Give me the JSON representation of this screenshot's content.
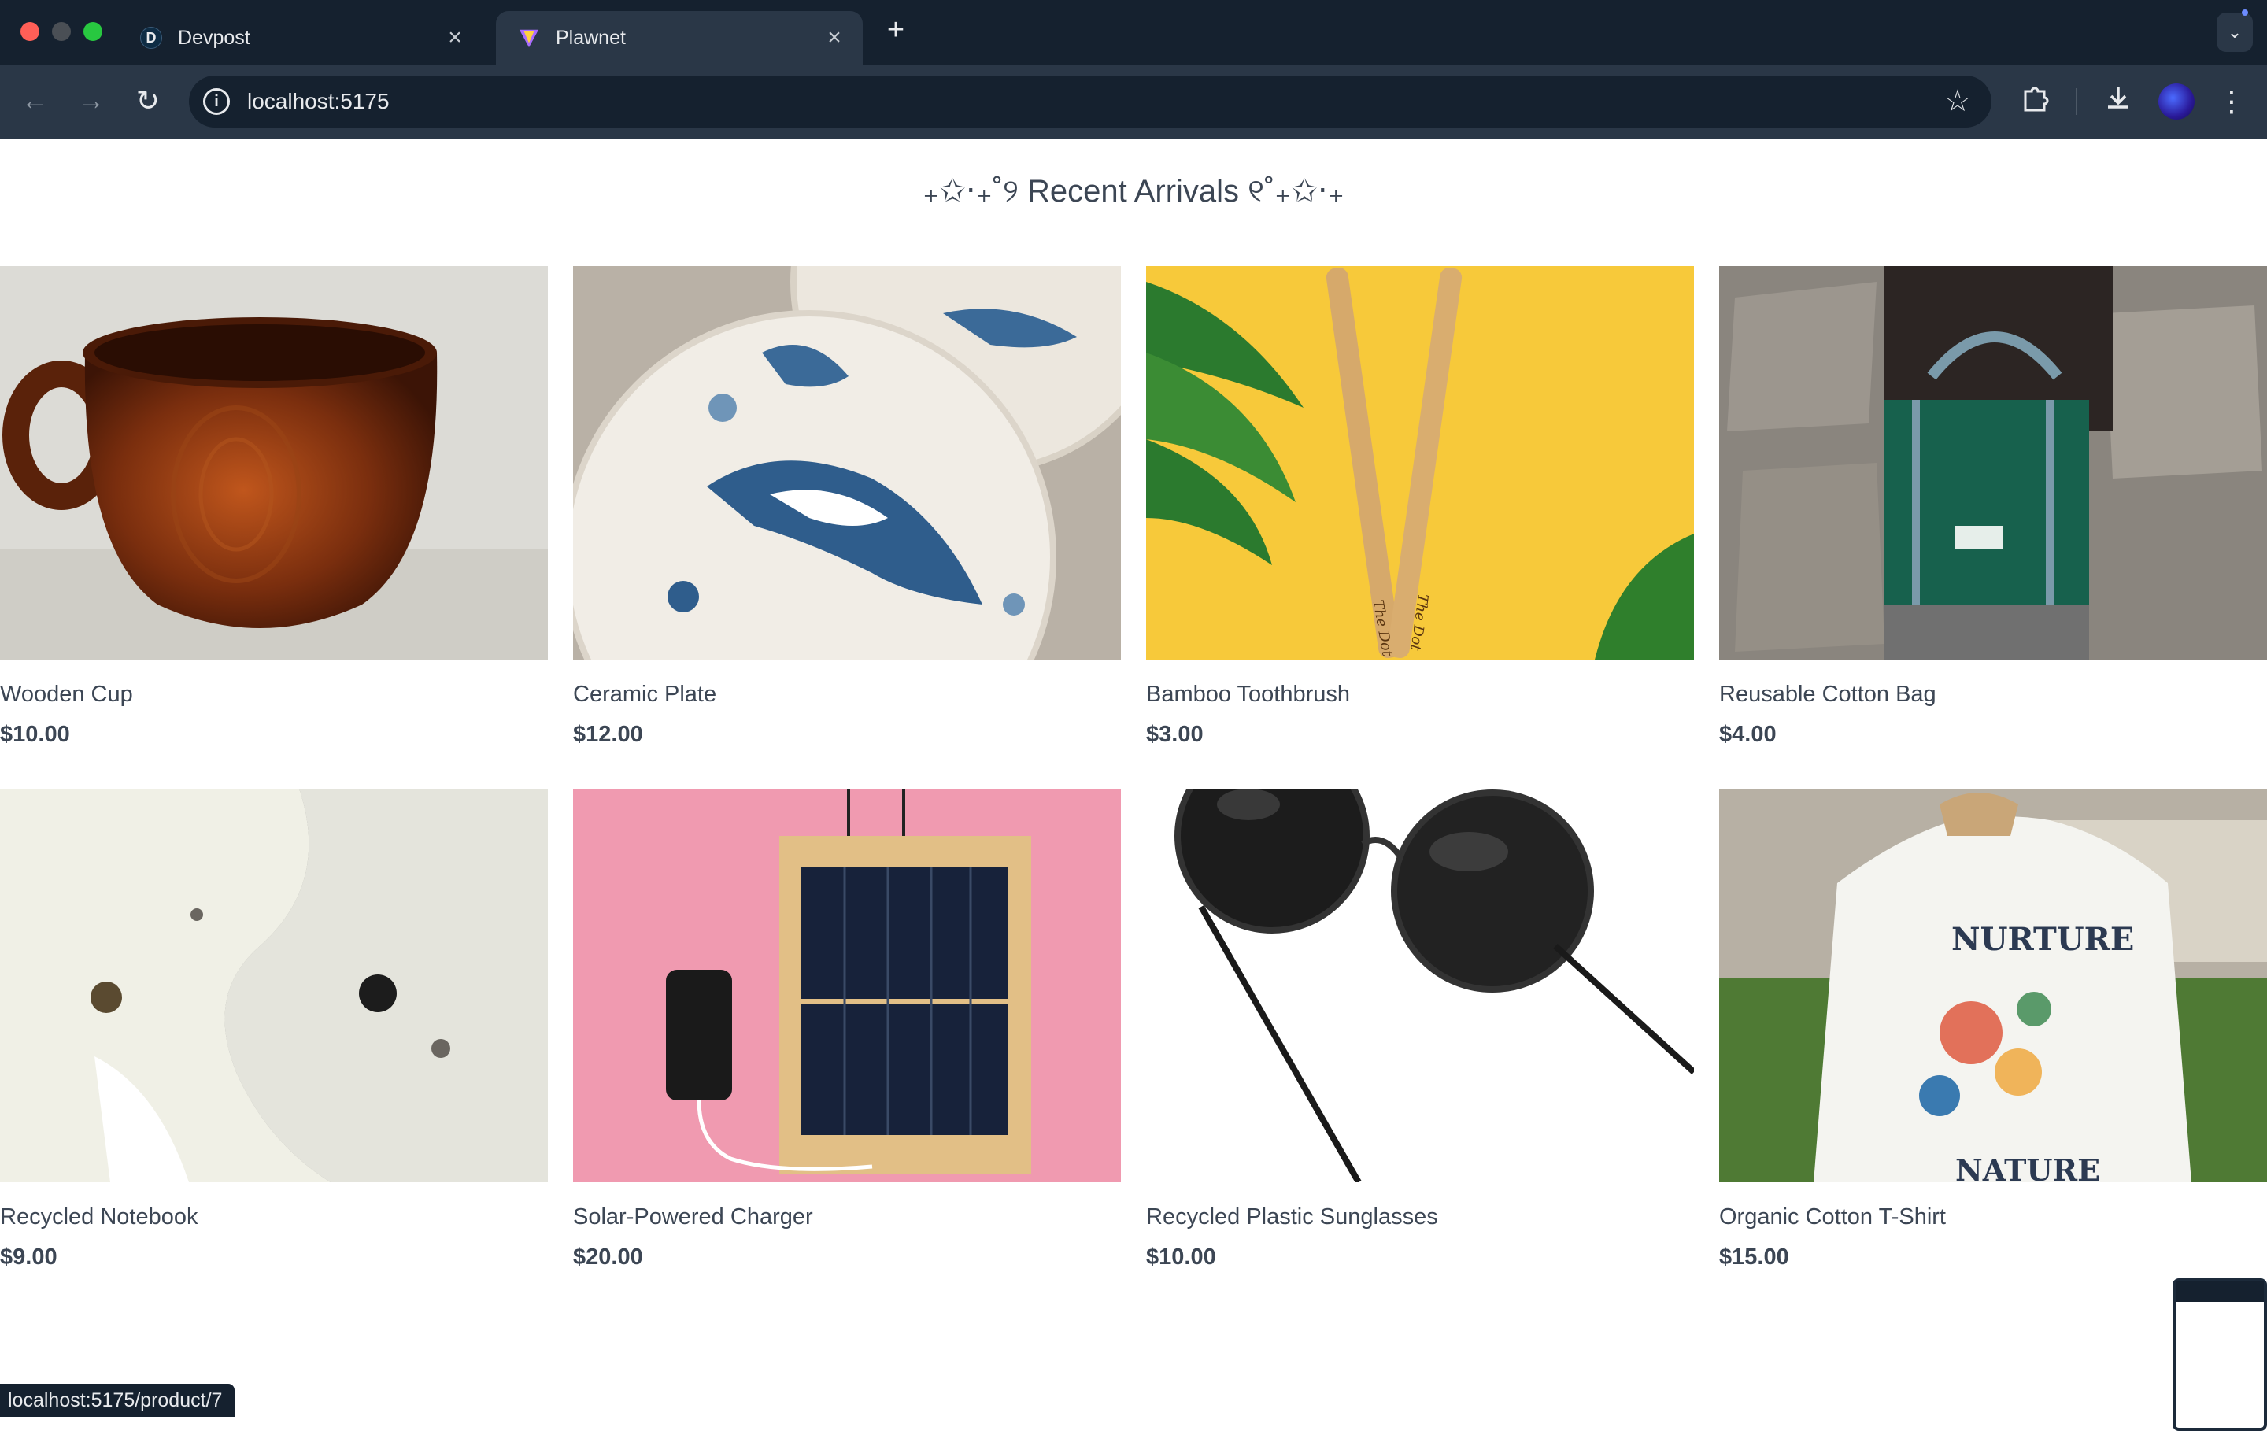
{
  "browser": {
    "tabs": [
      {
        "label": "Devpost",
        "favicon": "D",
        "active": false
      },
      {
        "label": "Plawnet",
        "favicon": "vite-icon",
        "active": true
      }
    ],
    "new_tab_icon": "+",
    "address": "localhost:5175",
    "status_url": "localhost:5175/product/7"
  },
  "page": {
    "heading": "₊✩‧₊˚୨ Recent Arrivals ୧˚₊✩‧₊"
  },
  "products": [
    {
      "name": "Wooden Cup",
      "price": "$10.00"
    },
    {
      "name": "Ceramic Plate",
      "price": "$12.00"
    },
    {
      "name": "Bamboo Toothbrush",
      "price": "$3.00"
    },
    {
      "name": "Reusable Cotton Bag",
      "price": "$4.00"
    },
    {
      "name": "Recycled Notebook",
      "price": "$9.00"
    },
    {
      "name": "Solar-Powered Charger",
      "price": "$20.00"
    },
    {
      "name": "Recycled Plastic Sunglasses",
      "price": "$10.00"
    },
    {
      "name": "Organic Cotton T-Shirt",
      "price": "$15.00"
    }
  ],
  "shirt_print": {
    "top": "NURTURE",
    "bottom": "NATURE"
  },
  "toothbrush_engraving": "The Dot",
  "colors": {
    "tabbar": "#15212f",
    "toolbar": "#2a3747",
    "text": "#3c4654"
  }
}
